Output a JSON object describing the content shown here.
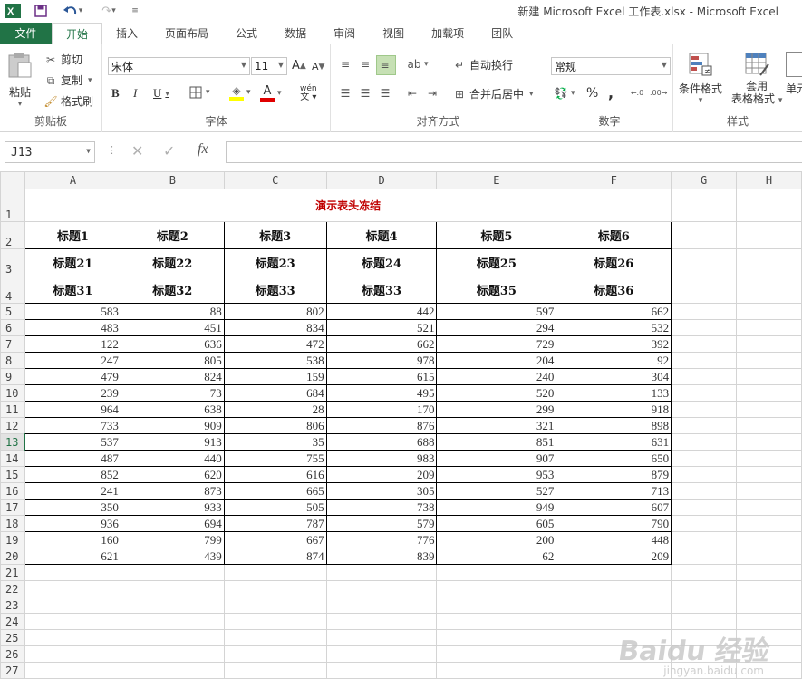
{
  "window": {
    "title": "新建 Microsoft Excel 工作表.xlsx - Microsoft Excel"
  },
  "tabs": [
    {
      "label": "文件"
    },
    {
      "label": "开始"
    },
    {
      "label": "插入"
    },
    {
      "label": "页面布局"
    },
    {
      "label": "公式"
    },
    {
      "label": "数据"
    },
    {
      "label": "审阅"
    },
    {
      "label": "视图"
    },
    {
      "label": "加载项"
    },
    {
      "label": "团队"
    }
  ],
  "ribbon": {
    "clipboard": {
      "label": "剪贴板",
      "paste": "粘贴",
      "cut": "剪切",
      "copy": "复制",
      "format_painter": "格式刷"
    },
    "font": {
      "label": "字体",
      "font_name": "宋体",
      "font_size": "11",
      "bold": "B",
      "italic": "I",
      "underline": "U",
      "phonetic": "wén",
      "grow": "A",
      "shrink": "A",
      "font_color": "A"
    },
    "alignment": {
      "label": "对齐方式",
      "wrap": "自动换行",
      "merge": "合并后居中"
    },
    "number": {
      "label": "数字",
      "format": "常规",
      "percent": "%",
      "comma": ","
    },
    "styles": {
      "label": "样式",
      "conditional": "条件格式",
      "table_format_1": "套用",
      "table_format_2": "表格格式",
      "cell_styles": "单元"
    }
  },
  "formula_bar": {
    "name_box": "J13",
    "fx": "fx",
    "value": ""
  },
  "columns": [
    "A",
    "B",
    "C",
    "D",
    "E",
    "F",
    "G",
    "H"
  ],
  "sheet": {
    "title": "演示表头冻结",
    "header_rows": [
      [
        "标题1",
        "标题2",
        "标题3",
        "标题4",
        "标题5",
        "标题6"
      ],
      [
        "标题21",
        "标题22",
        "标题23",
        "标题24",
        "标题25",
        "标题26"
      ],
      [
        "标题31",
        "标题32",
        "标题33",
        "标题33",
        "标题35",
        "标题36"
      ]
    ],
    "rows": [
      [
        583,
        88,
        802,
        442,
        597,
        662
      ],
      [
        483,
        451,
        834,
        521,
        294,
        532
      ],
      [
        122,
        636,
        472,
        662,
        729,
        392
      ],
      [
        247,
        805,
        538,
        978,
        204,
        92
      ],
      [
        479,
        824,
        159,
        615,
        240,
        304
      ],
      [
        239,
        73,
        684,
        495,
        520,
        133
      ],
      [
        964,
        638,
        28,
        170,
        299,
        918
      ],
      [
        733,
        909,
        806,
        876,
        321,
        898
      ],
      [
        537,
        913,
        35,
        688,
        851,
        631
      ],
      [
        487,
        440,
        755,
        983,
        907,
        650
      ],
      [
        852,
        620,
        616,
        209,
        953,
        879
      ],
      [
        241,
        873,
        665,
        305,
        527,
        713
      ],
      [
        350,
        933,
        505,
        738,
        949,
        607
      ],
      [
        936,
        694,
        787,
        579,
        605,
        790
      ],
      [
        160,
        799,
        667,
        776,
        200,
        448
      ],
      [
        621,
        439,
        874,
        839,
        62,
        209
      ]
    ],
    "empty_row_numbers": [
      "21",
      "22",
      "23",
      "24",
      "25",
      "26",
      "27"
    ],
    "selected_row": "13"
  },
  "watermark": {
    "text": "Baidu 经验",
    "sub": "jingyan.baidu.com"
  },
  "colors": {
    "accent": "#217346",
    "title_red": "#c00000"
  }
}
